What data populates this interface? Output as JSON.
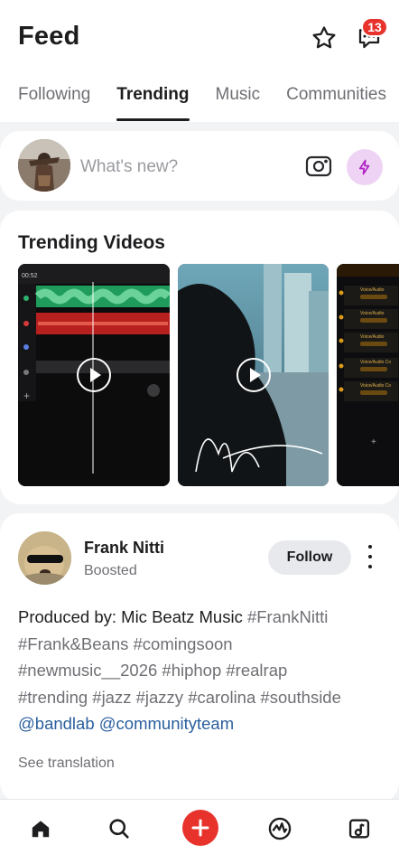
{
  "header": {
    "title": "Feed",
    "notifications_count": "13",
    "tabs": [
      {
        "label": "Following",
        "active": false
      },
      {
        "label": "Trending",
        "active": true
      },
      {
        "label": "Music",
        "active": false
      },
      {
        "label": "Communities",
        "active": false
      }
    ]
  },
  "composer": {
    "placeholder": "What's new?",
    "icons": [
      "camera-icon",
      "bolt-icon"
    ]
  },
  "trending_videos": {
    "title": "Trending Videos",
    "items": [
      {
        "kind": "daw-waveform-video",
        "top_label": "00:52"
      },
      {
        "kind": "city-silhouette-video"
      },
      {
        "kind": "vocal-track-list-video",
        "lines": [
          "Voice/Audio",
          "Voice/Audio",
          "Voice/Audio",
          "Voice/Audio Co",
          "Voice/Audio Co"
        ]
      }
    ]
  },
  "post": {
    "author": "Frank Nitti",
    "subtitle": "Boosted",
    "follow_label": "Follow",
    "text_prefix": "Produced by: Mic Beatz Music ",
    "hashtags_1": "#FrankNitti",
    "hashtags_2": "#Frank&Beans #comingsoon",
    "hashtags_3": "#newmusic__2026 #hiphop #realrap",
    "hashtags_4": "#trending #jazz #jazzy #carolina #southside",
    "mentions": "@bandlab @communityteam",
    "see_translation": "See translation"
  },
  "bottom_nav": {
    "items": [
      "home-icon",
      "search-icon",
      "create-plus-icon",
      "activity-icon",
      "library-icon"
    ]
  },
  "colors": {
    "accent_red": "#e8332d",
    "bolt_bg": "#efd3f4",
    "mention_blue": "#2a5f9e",
    "page_bg": "#f2f3f5"
  }
}
